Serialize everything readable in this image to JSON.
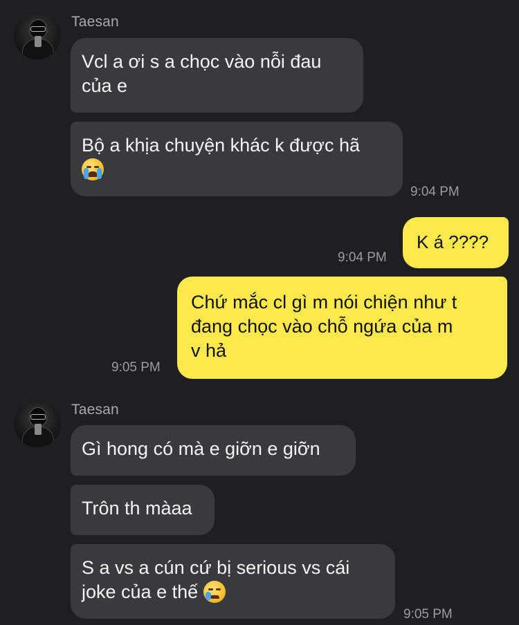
{
  "messages": {
    "group1": {
      "sender": "Taesan",
      "m1_line1": "Vcl a ơi s a chọc vào nỗi đau",
      "m1_line2": "của e",
      "m2_line1": "Bộ a khịa chuyện khác k được hã",
      "m2_emoji": "loudly-crying-face-emoji",
      "time": "9:04 PM"
    },
    "out1": {
      "text": "K á ????",
      "time": "9:04 PM"
    },
    "out2": {
      "line1": "Chứ mắc cl gì m nói chiện như t",
      "line2": "đang chọc vào chỗ ngứa của m",
      "line3": "v hả",
      "time": "9:05 PM"
    },
    "group2": {
      "sender": "Taesan",
      "m1": "Gì hong có mà e giỡn e giỡn",
      "m2": "Trôn th màaa",
      "m3_line1": "S a vs a cún cứ bị serious vs cái",
      "m3_line2": "joke của e thế",
      "m3_emoji": "crying-face-emoji",
      "time": "9:05 PM"
    }
  },
  "colors": {
    "background": "#1f1f21",
    "incoming_bubble": "#3a3a3c",
    "outgoing_bubble": "#fbe84a",
    "timestamp": "#9c9ca1"
  }
}
